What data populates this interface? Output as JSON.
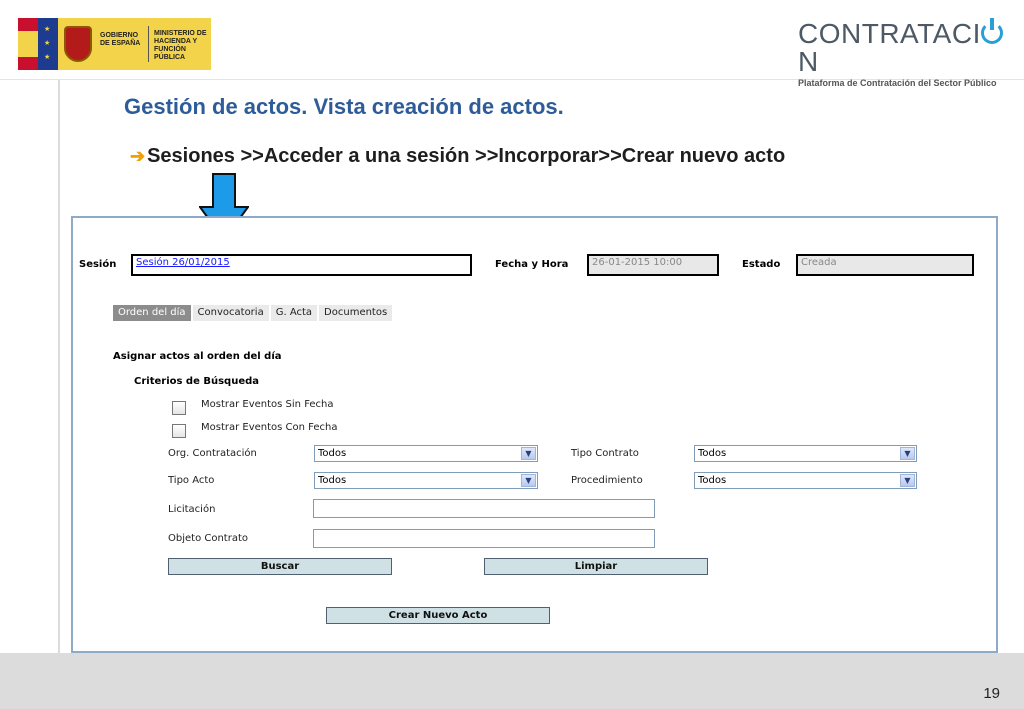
{
  "header": {
    "gov_line1": "GOBIERNO DE ESPAÑA",
    "gov_line2": "MINISTERIO DE HACIENDA Y FUNCIÓN PÚBLICA",
    "brand_main": "CONTRATACI",
    "brand_last": "N",
    "brand_sub": "Plataforma de Contratación del Sector Público"
  },
  "slide": {
    "title": "Gestión de actos. Vista creación de actos.",
    "path_icon": "➔",
    "path_text": "Sesiones >>Acceder a una sesión >>Incorporar>>Crear nuevo acto",
    "page_number": "19"
  },
  "session": {
    "label": "Sesión",
    "value": "Sesión 26/01/2015",
    "datetime_label": "Fecha y Hora",
    "datetime_value": "26-01-2015 10:00",
    "status_label": "Estado",
    "status_value": "Creada"
  },
  "tabs": [
    {
      "label": "Orden del día",
      "active": true
    },
    {
      "label": "Convocatoria",
      "active": false
    },
    {
      "label": "G. Acta",
      "active": false
    },
    {
      "label": "Documentos",
      "active": false
    }
  ],
  "form": {
    "section_title": "Asignar actos al orden del día",
    "criteria_title": "Criterios de Búsqueda",
    "cb_sin_fecha": "Mostrar Eventos Sin Fecha",
    "cb_con_fecha": "Mostrar Eventos Con Fecha",
    "org_label": "Org. Contratación",
    "org_value": "Todos",
    "tipo_contrato_label": "Tipo Contrato",
    "tipo_contrato_value": "Todos",
    "tipo_acto_label": "Tipo Acto",
    "tipo_acto_value": "Todos",
    "procedimiento_label": "Procedimiento",
    "procedimiento_value": "Todos",
    "licitacion_label": "Licitación",
    "objeto_label": "Objeto Contrato",
    "buscar_label": "Buscar",
    "limpiar_label": "Limpiar",
    "crear_label": "Crear Nuevo Acto"
  },
  "colors": {
    "title_blue": "#2e5c99",
    "arrow_blue": "#1e9be8",
    "panel_border": "#8fa9c8"
  }
}
